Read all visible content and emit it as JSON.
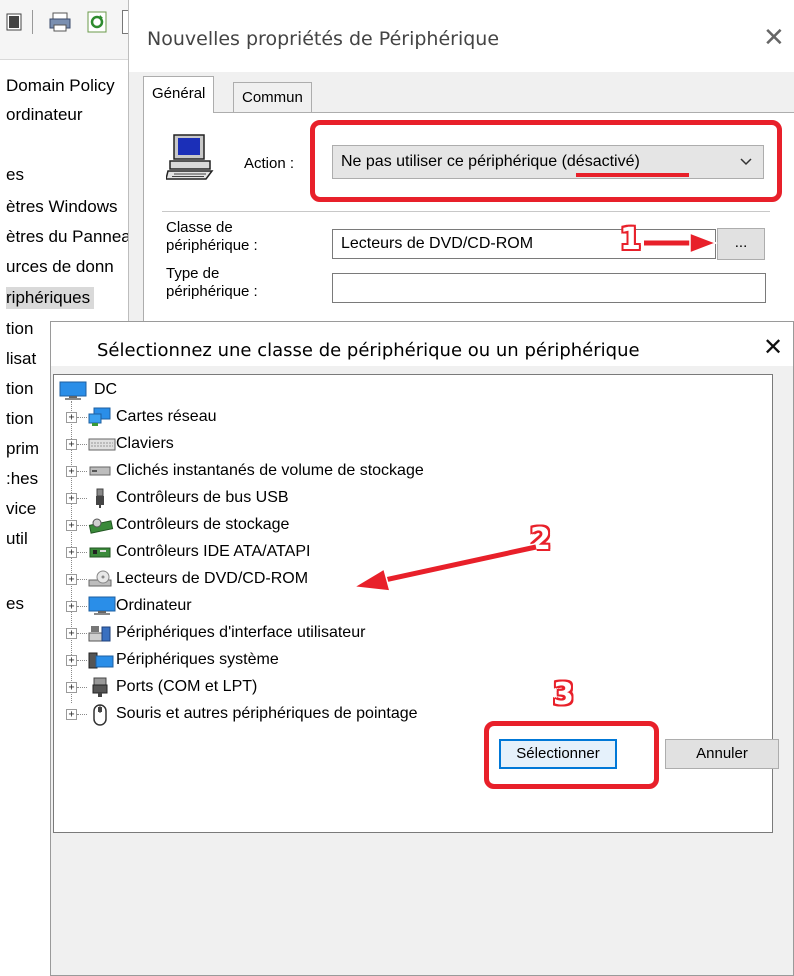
{
  "background_console": {
    "tree_items": [
      "Domain Policy",
      "ordinateur",
      "es",
      "ètres Windows",
      "ètres du Panneau",
      "urces de donn",
      "riphériques",
      "tion",
      "lisat",
      "tion",
      "tion",
      "prim",
      ":hes",
      "vice",
      "util",
      "es"
    ]
  },
  "properties_dialog": {
    "title": "Nouvelles propriétés de Périphérique",
    "close_glyph": "✕",
    "tabs": [
      {
        "label": "Général"
      },
      {
        "label": "Commun"
      }
    ],
    "action_label": "Action :",
    "action_value": "Ne pas utiliser ce périphérique (désactivé)",
    "class_label": "Classe de périphérique :",
    "class_value": "Lecteurs de DVD/CD-ROM",
    "browse_label": "...",
    "type_label": "Type de périphérique :",
    "type_value": ""
  },
  "select_dialog": {
    "title": "Sélectionnez une classe de périphérique ou un périphérique",
    "close_glyph": "✕",
    "root_label": "DC",
    "tree_items": [
      {
        "label": "Cartes réseau",
        "icon": "network-adapter-icon"
      },
      {
        "label": "Claviers",
        "icon": "keyboard-icon"
      },
      {
        "label": "Clichés instantanés de volume de stockage",
        "icon": "storage-volume-icon"
      },
      {
        "label": "Contrôleurs de bus USB",
        "icon": "usb-icon"
      },
      {
        "label": "Contrôleurs de stockage",
        "icon": "storage-controller-icon"
      },
      {
        "label": "Contrôleurs IDE ATA/ATAPI",
        "icon": "ide-controller-icon"
      },
      {
        "label": "Lecteurs de DVD/CD-ROM",
        "icon": "dvd-drive-icon"
      },
      {
        "label": "Ordinateur",
        "icon": "computer-icon"
      },
      {
        "label": "Périphériques d'interface utilisateur",
        "icon": "hid-icon"
      },
      {
        "label": "Périphériques système",
        "icon": "system-devices-icon"
      },
      {
        "label": "Ports (COM et LPT)",
        "icon": "ports-icon"
      },
      {
        "label": "Souris et autres périphériques de pointage",
        "icon": "mouse-icon"
      }
    ],
    "expander_glyph": "+",
    "select_button": "Sélectionner",
    "cancel_button": "Annuler"
  },
  "annotations": {
    "step_1": "1",
    "step_2": "2",
    "step_3": "3"
  },
  "colors": {
    "annotation_red": "#e8202a",
    "dialog_bg": "#f0f0f0",
    "default_button_border": "#0078d7"
  }
}
